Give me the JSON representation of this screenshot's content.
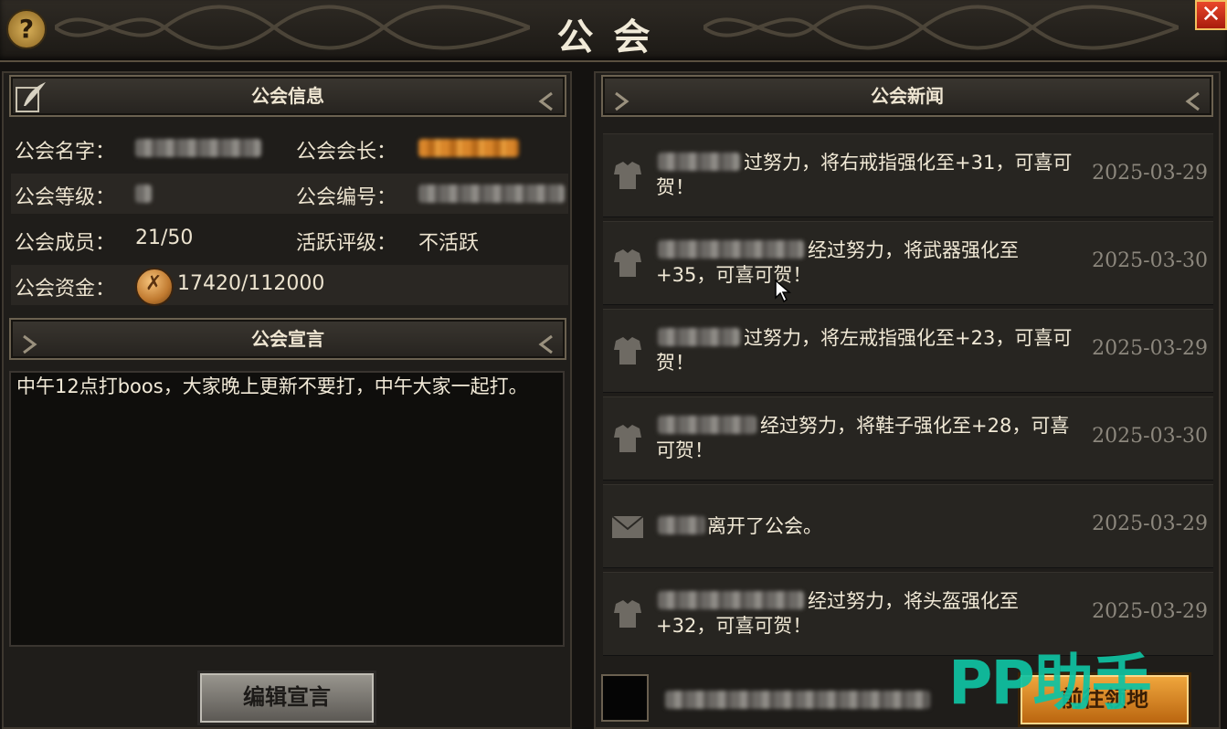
{
  "window": {
    "title": "公会"
  },
  "left": {
    "info_header": "公会信息",
    "rows": [
      {
        "label1": "公会名字：",
        "label2": "公会会长："
      },
      {
        "label1": "公会等级：",
        "label2": "公会编号："
      },
      {
        "label1": "公会成员：",
        "value1": "21/50",
        "label2": "活跃评级：",
        "value2": "不活跃"
      },
      {
        "label1": "公会资金：",
        "value1": "17420/112000"
      }
    ],
    "declaration_header": "公会宣言",
    "declaration_text": "中午12点打boos，大家晚上更新不要打，中午大家一起打。",
    "edit_button": "编辑宣言"
  },
  "right": {
    "news_header": "公会新闻",
    "news": [
      {
        "icon": "armor-icon",
        "text": "过努力，将右戒指强化至+31，可喜可贺！",
        "date": "2025-03-29"
      },
      {
        "icon": "armor-icon",
        "text": "经过努力，将武器强化至+35，可喜可贺！",
        "date": "2025-03-30"
      },
      {
        "icon": "armor-icon",
        "text": "过努力，将左戒指强化至+23，可喜可贺！",
        "date": "2025-03-29"
      },
      {
        "icon": "armor-icon",
        "text": "经过努力，将鞋子强化至+28，可喜可贺！",
        "date": "2025-03-30"
      },
      {
        "icon": "envelope-icon",
        "text": "离开了公会。",
        "date": "2025-03-29"
      },
      {
        "icon": "armor-icon",
        "text": "经过努力，将头盔强化至+32，可喜可贺！",
        "date": "2025-03-29"
      }
    ],
    "goto_button": "前往领地"
  },
  "watermark": "PP助手",
  "colors": {
    "accent_orange": "#d98a25",
    "watermark_teal": "#0fc3a3",
    "close_red": "#d3331b"
  }
}
